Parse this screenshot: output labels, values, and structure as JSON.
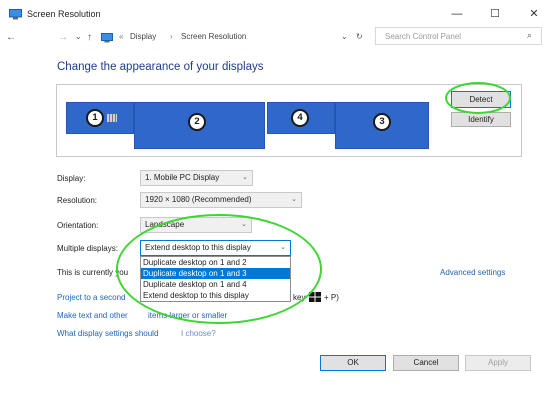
{
  "window": {
    "title": "Screen Resolution",
    "controls": {
      "minimize": "—",
      "maximize": "☐",
      "close": "✕"
    }
  },
  "address_bar": {
    "back": "←",
    "forward": "→",
    "recent": "⌄",
    "up": "↑",
    "crumb_separator": "›",
    "crumb_lead": "«",
    "breadcrumbs": [
      "Display",
      "Screen Resolution"
    ],
    "dropdown": "⌄",
    "refresh": "↻",
    "search_placeholder": "Search Control Panel",
    "search_icon": "⌕"
  },
  "heading": "Change the appearance of your displays",
  "monitors": [
    {
      "number": "1",
      "active": true
    },
    {
      "number": "2"
    },
    {
      "number": "4"
    },
    {
      "number": "3"
    }
  ],
  "buttons": {
    "detect": "Detect",
    "identify": "Identify",
    "ok": "OK",
    "cancel": "Cancel",
    "apply": "Apply"
  },
  "form": {
    "display_label": "Display:",
    "display_value": "1. Mobile PC Display",
    "resolution_label": "Resolution:",
    "resolution_value": "1920 × 1080 (Recommended)",
    "orientation_label": "Orientation:",
    "orientation_value": "Landscape",
    "multiple_label": "Multiple displays:",
    "multiple_value": "Extend desktop to this display",
    "chevron": "⌄"
  },
  "multiple_options": [
    "Duplicate desktop on 1 and 2",
    "Duplicate desktop on 1 and 3",
    "Duplicate desktop on 1 and 4",
    "Extend desktop to this display"
  ],
  "multiple_selected_index": 1,
  "info_text": "This is currently you",
  "advanced_link": "Advanced settings",
  "links": {
    "project_prefix": "Project to a second",
    "project_suffix": "key",
    "project_shortcut": "+ P)",
    "text_larger_prefix": "Make text and other",
    "text_larger_suffix": "items larger or smaller",
    "which_settings_prefix": "What display settings should",
    "which_settings_suffix": "I choose?"
  },
  "colors": {
    "accent": "#0078d7",
    "heading": "#1e3d8a",
    "monitor": "#2f68c8",
    "link": "#1f64b4",
    "highlight": "#3dd632"
  }
}
